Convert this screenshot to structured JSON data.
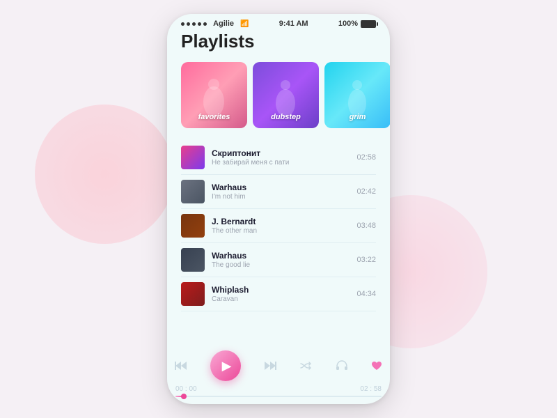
{
  "statusBar": {
    "dots": [
      "●",
      "●",
      "●",
      "●",
      "●"
    ],
    "carrier": "Agilie",
    "time": "9:41 AM",
    "battery": "100%"
  },
  "page": {
    "title": "Playlists"
  },
  "playlists": [
    {
      "id": "favorites",
      "label": "favorites",
      "colorClass": "card-favorites"
    },
    {
      "id": "dubstep",
      "label": "dubstep",
      "colorClass": "card-dubstep"
    },
    {
      "id": "grim",
      "label": "grim",
      "colorClass": "card-grim"
    }
  ],
  "tracks": [
    {
      "id": 1,
      "artist": "Скриптонит",
      "title": "Не забирай меня с пати",
      "duration": "02:58",
      "thumbClass": "track-thumb-1"
    },
    {
      "id": 2,
      "artist": "Warhaus",
      "title": "I'm not him",
      "duration": "02:42",
      "thumbClass": "track-thumb-2"
    },
    {
      "id": 3,
      "artist": "J. Bernardt",
      "title": "The other man",
      "duration": "03:48",
      "thumbClass": "track-thumb-3"
    },
    {
      "id": 4,
      "artist": "Warhaus",
      "title": "The good lie",
      "duration": "03:22",
      "thumbClass": "track-thumb-4"
    },
    {
      "id": 5,
      "artist": "Whiplash",
      "title": "Caravan",
      "duration": "04:34",
      "thumbClass": "track-thumb-5"
    }
  ],
  "player": {
    "prevLabel": "⏮",
    "playLabel": "▶",
    "nextLabel": "⏭",
    "shuffleLabel": "⇄",
    "headphonesLabel": "🎧",
    "heartLabel": "♥",
    "currentTime": "00 : 00",
    "totalTime": "02 : 58",
    "progressPercent": 4
  }
}
